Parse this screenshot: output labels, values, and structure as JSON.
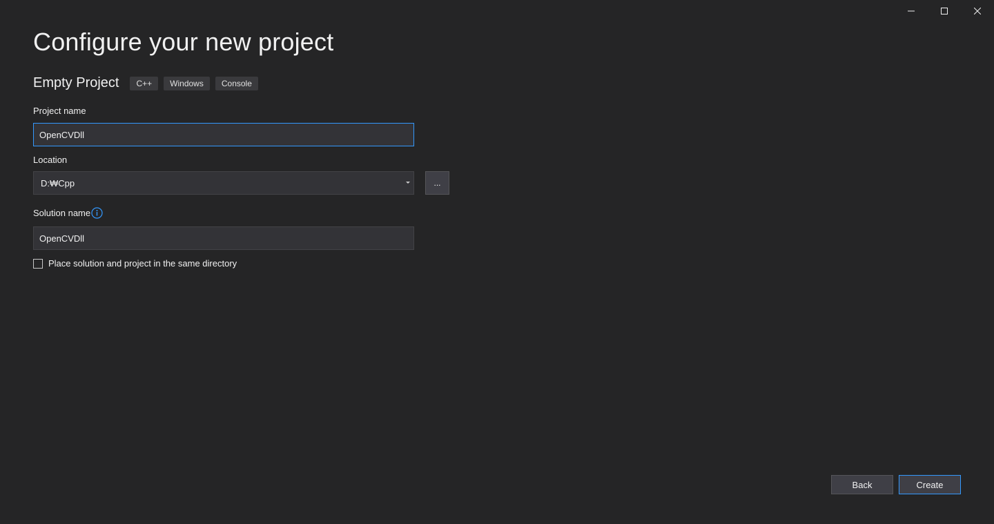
{
  "window": {
    "controls": {
      "minimize_icon": "minimize-icon",
      "maximize_icon": "maximize-icon",
      "close_icon": "close-icon"
    }
  },
  "page": {
    "title": "Configure your new project"
  },
  "template": {
    "name": "Empty Project",
    "tags": [
      "C++",
      "Windows",
      "Console"
    ]
  },
  "form": {
    "project_name": {
      "label": "Project name",
      "value": "OpenCVDll"
    },
    "location": {
      "label": "Location",
      "value": "D:₩Cpp",
      "browse_label": "..."
    },
    "solution_name": {
      "label": "Solution name",
      "value": "OpenCVDll",
      "info_icon": "info-icon"
    },
    "same_directory": {
      "label": "Place solution and project in the same directory",
      "checked": false
    }
  },
  "footer": {
    "back_label": "Back",
    "create_label": "Create"
  },
  "colors": {
    "background": "#252526",
    "input_background": "#333337",
    "accent": "#3399ff",
    "tag_background": "#3a3a3d"
  }
}
